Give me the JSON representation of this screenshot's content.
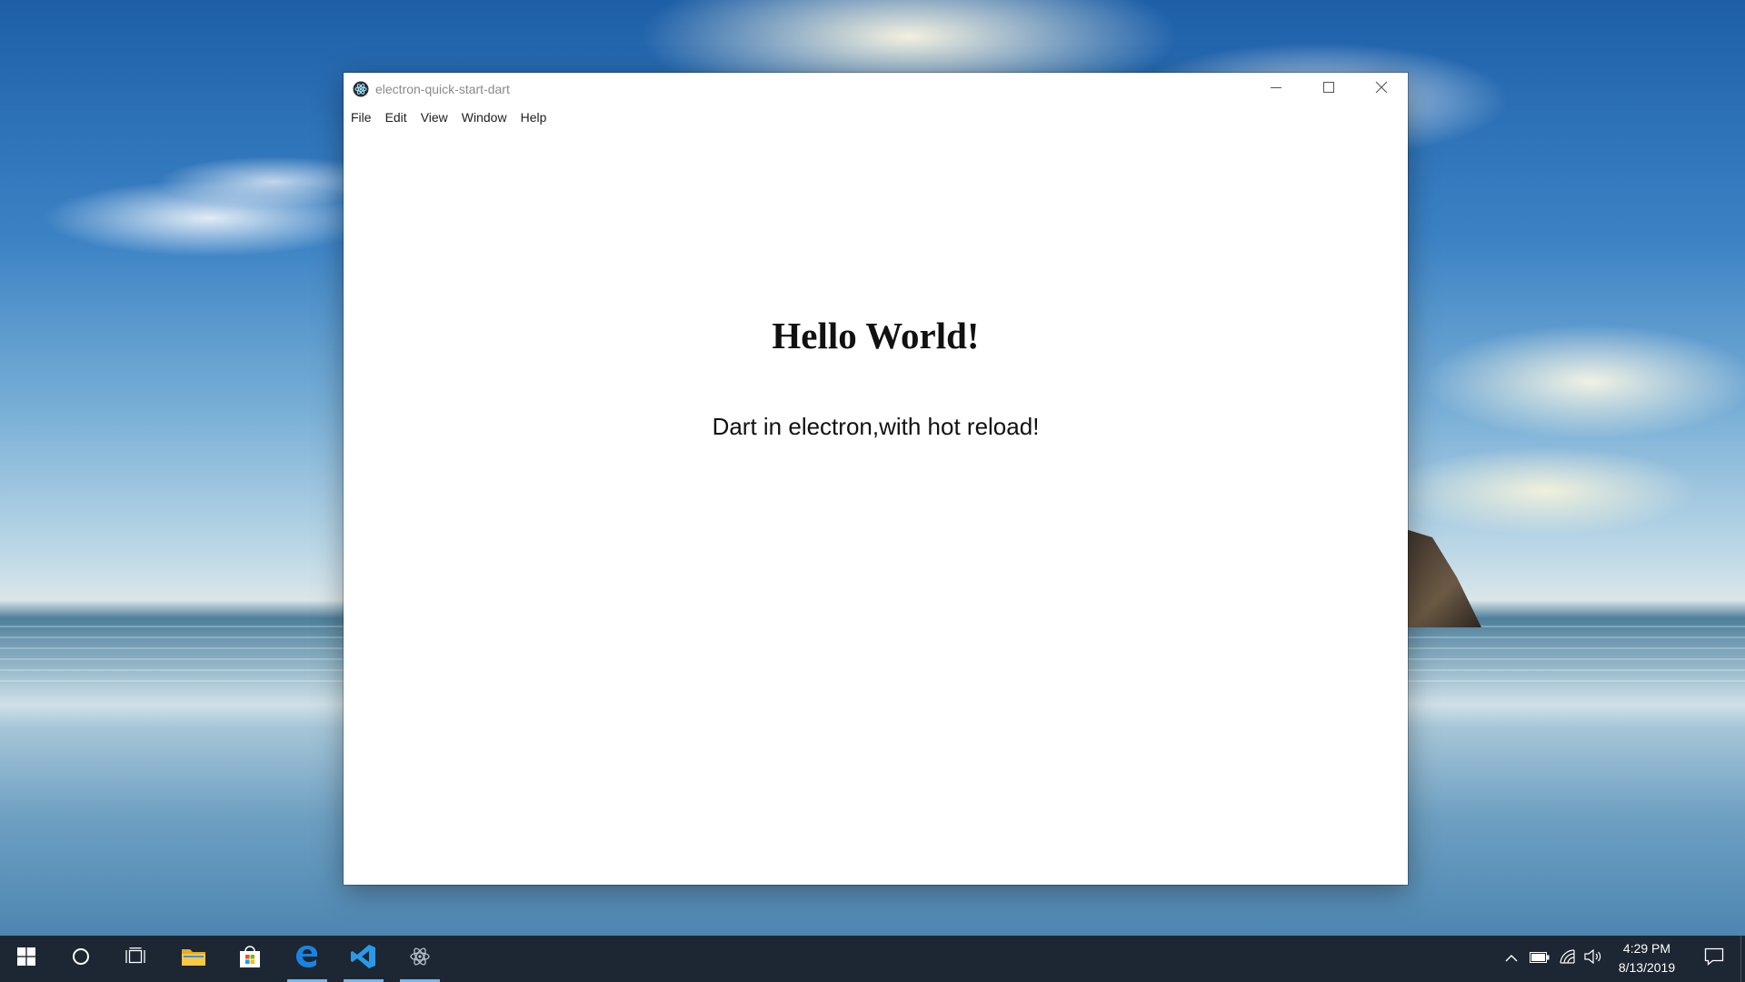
{
  "window": {
    "title": "electron-quick-start-dart",
    "app_icon": "electron-icon",
    "controls": {
      "minimize_icon": "minimize-icon",
      "maximize_icon": "maximize-icon",
      "close_icon": "close-icon"
    },
    "menu": [
      {
        "label": "File"
      },
      {
        "label": "Edit"
      },
      {
        "label": "View"
      },
      {
        "label": "Window"
      },
      {
        "label": "Help"
      }
    ]
  },
  "page": {
    "heading": "Hello World!",
    "subtext": "Dart in electron,with hot reload!"
  },
  "taskbar": {
    "apps": [
      {
        "name": "start-button",
        "icon": "windows-logo-icon",
        "active": false
      },
      {
        "name": "cortana-button",
        "icon": "cortana-circle-icon",
        "active": false
      },
      {
        "name": "task-view-button",
        "icon": "task-view-icon",
        "active": false
      },
      {
        "name": "file-explorer",
        "icon": "folder-icon",
        "active": false
      },
      {
        "name": "microsoft-store",
        "icon": "store-bag-icon",
        "active": false
      },
      {
        "name": "edge-browser",
        "icon": "edge-icon",
        "active": true
      },
      {
        "name": "vscode",
        "icon": "vscode-icon",
        "active": true
      },
      {
        "name": "electron-app",
        "icon": "electron-icon",
        "active": true
      }
    ],
    "tray": {
      "icons": [
        "chevron-up-icon",
        "battery-icon",
        "wifi-icon",
        "volume-icon"
      ],
      "time": "4:29 PM",
      "date": "8/13/2019",
      "notification_icon": "action-center-icon"
    },
    "accent_color": "#7ab4ea",
    "background_color": "#1c2733"
  }
}
